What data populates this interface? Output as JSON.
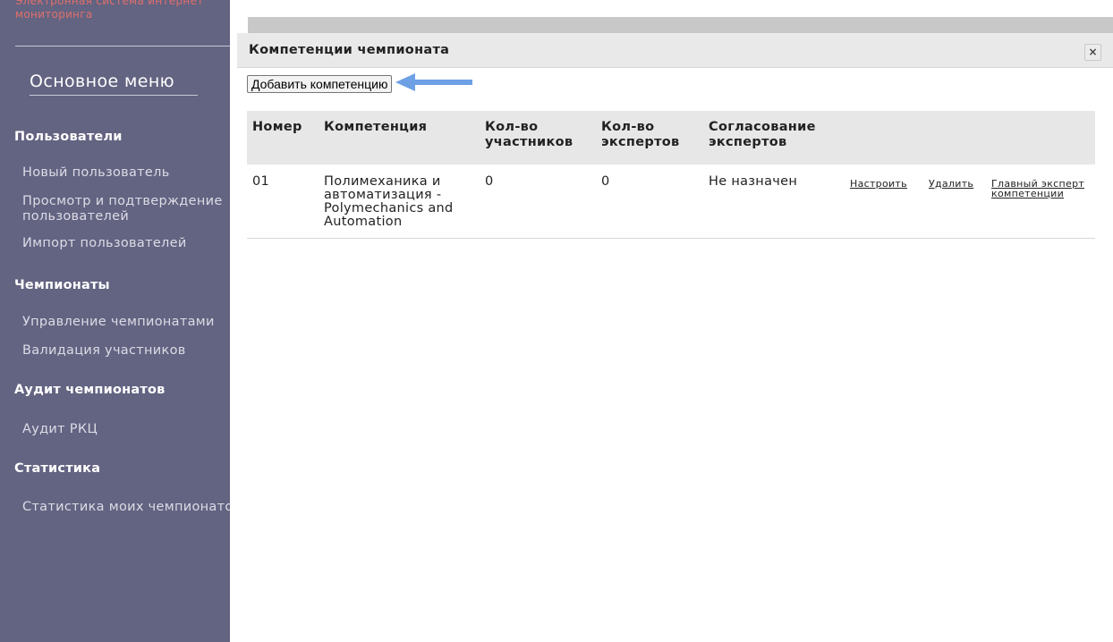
{
  "sidebar": {
    "brand": "Электронная система интернет мониторинга",
    "menu_title": "Основное меню",
    "sections": [
      {
        "heading": "Пользователи",
        "items": [
          "Новый пользователь",
          "Просмотр и подтверждение пользователей",
          "Импорт пользователей"
        ]
      },
      {
        "heading": "Чемпионаты",
        "items": [
          "Управление чемпионатами",
          "Валидация участников"
        ]
      },
      {
        "heading": "Аудит чемпионатов",
        "items": [
          "Аудит РКЦ"
        ]
      },
      {
        "heading": "Статистика",
        "items": [
          "Статистика моих чемпионатов"
        ]
      }
    ]
  },
  "modal": {
    "title": "Компетенции чемпионата",
    "close_icon": "close-icon",
    "close_glyph": "×",
    "add_button_label": "Добавить компетенцию",
    "annotation_arrow_color": "#6ea0e6",
    "table": {
      "headers": [
        "Номер",
        "Компетенция",
        "Кол-во участников",
        "Кол-во экспертов",
        "Согласование экспертов"
      ],
      "rows": [
        {
          "number": "01",
          "competence": "Полимеханика и автоматизация - Polymechanics and Automation",
          "participants": "0",
          "experts": "0",
          "approval": "Не назначен",
          "action_configure": "Настроить",
          "action_delete": "Удалить",
          "action_chief_expert": "Главный эксперт компетенции"
        }
      ]
    }
  },
  "colors": {
    "sidebar_bg": "#636382",
    "brand_text": "#e0706a",
    "header_bg": "#e9e9e9",
    "table_header_bg": "#e7e7e7"
  }
}
